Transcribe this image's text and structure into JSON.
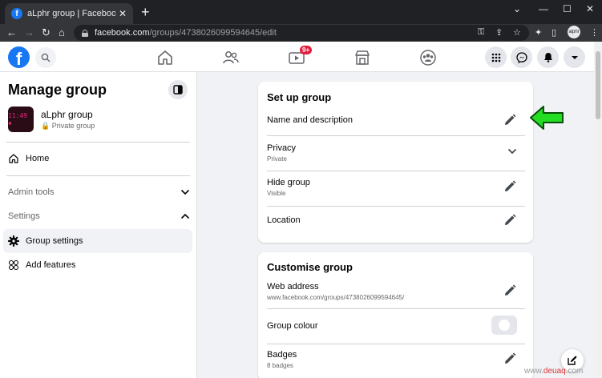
{
  "browser": {
    "tab_title": "aLphr group | Facebook",
    "tab_close": "✕",
    "new_tab": "+",
    "url_domain": "facebook.com",
    "url_path": "/groups/4738026099594645/edit",
    "profile_label": "alphr"
  },
  "header": {
    "notification_badge": "9+"
  },
  "sidebar": {
    "title": "Manage group",
    "group_name": "aLphr group",
    "group_privacy": "Private group",
    "group_thumb_text": "11:49 ▪",
    "items": [
      {
        "label": "Home",
        "icon": "home-icon"
      },
      {
        "label": "Group settings",
        "icon": "gear-icon"
      },
      {
        "label": "Add features",
        "icon": "features-icon"
      }
    ],
    "sections": [
      {
        "label": "Admin tools",
        "state": "collapsed"
      },
      {
        "label": "Settings",
        "state": "expanded"
      }
    ]
  },
  "setup_card": {
    "title": "Set up group",
    "rows": [
      {
        "label": "Name and description",
        "sub": "",
        "icon": "pencil-icon"
      },
      {
        "label": "Privacy",
        "sub": "Private",
        "icon": "chevron-down-icon"
      },
      {
        "label": "Hide group",
        "sub": "Visible",
        "icon": "pencil-icon"
      },
      {
        "label": "Location",
        "sub": "",
        "icon": "pencil-icon"
      }
    ]
  },
  "customise_card": {
    "title": "Customise group",
    "rows": [
      {
        "label": "Web address",
        "sub": "www.facebook.com/groups/4738026099594645/",
        "icon": "pencil-icon"
      },
      {
        "label": "Group colour",
        "sub": "",
        "icon": "color-swatch"
      },
      {
        "label": "Badges",
        "sub": "8 badges",
        "icon": "pencil-icon"
      }
    ]
  },
  "watermark": {
    "pre": "www.",
    "brand": "deuaq",
    "post": ".com"
  },
  "colors": {
    "fb_blue": "#1877f2",
    "arrow_green": "#22dd22",
    "badge_red": "#e41e3f"
  }
}
